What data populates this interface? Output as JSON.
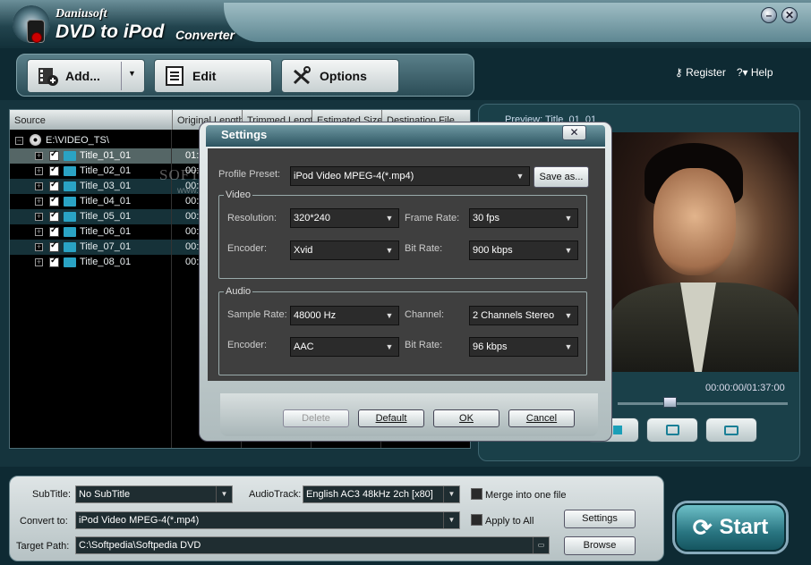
{
  "app": {
    "brand": "Daniusoft",
    "product": "DVD to iPod",
    "product_suffix": "Converter",
    "minimize_glyph": "–",
    "close_glyph": "✕"
  },
  "toolbar": {
    "add_label": "Add...",
    "edit_label": "Edit",
    "options_label": "Options",
    "register_label": "Register",
    "help_label": "Help"
  },
  "list": {
    "columns": [
      "Source",
      "Original Length",
      "Trimmed Length",
      "Estimated Size",
      "Destination File"
    ],
    "root": "E:\\VIDEO_TS\\",
    "items": [
      {
        "title": "Title_01_01",
        "length": "01:"
      },
      {
        "title": "Title_02_01",
        "length": "00:"
      },
      {
        "title": "Title_03_01",
        "length": "00:"
      },
      {
        "title": "Title_04_01",
        "length": "00:"
      },
      {
        "title": "Title_05_01",
        "length": "00:"
      },
      {
        "title": "Title_06_01",
        "length": "00:"
      },
      {
        "title": "Title_07_01",
        "length": "00:"
      },
      {
        "title": "Title_08_01",
        "length": "00:"
      }
    ]
  },
  "preview": {
    "title": "Preview: Title_01_01",
    "time": "00:00:00/01:37:00"
  },
  "settings": {
    "title": "Settings",
    "profile_label": "Profile Preset:",
    "profile_value": "iPod Video MPEG-4(*.mp4)",
    "save_as": "Save as...",
    "video_group": "Video",
    "resolution_label": "Resolution:",
    "resolution_value": "320*240",
    "frame_rate_label": "Frame Rate:",
    "frame_rate_value": "30 fps",
    "video_encoder_label": "Encoder:",
    "video_encoder_value": "Xvid",
    "video_bitrate_label": "Bit Rate:",
    "video_bitrate_value": "900 kbps",
    "audio_group": "Audio",
    "sample_rate_label": "Sample Rate:",
    "sample_rate_value": "48000 Hz",
    "channel_label": "Channel:",
    "channel_value": "2 Channels Stereo",
    "audio_encoder_label": "Encoder:",
    "audio_encoder_value": "AAC",
    "audio_bitrate_label": "Bit Rate:",
    "audio_bitrate_value": "96 kbps",
    "delete": "Delete",
    "default": "Default",
    "ok": "OK",
    "cancel": "Cancel"
  },
  "bottom": {
    "subtitle_label": "SubTitle:",
    "subtitle_value": "No SubTitle",
    "audiotrack_label": "AudioTrack:",
    "audiotrack_value": "English AC3 48kHz 2ch [x80]",
    "merge_label": "Merge into one file",
    "convert_label": "Convert to:",
    "convert_value": "iPod Video MPEG-4(*.mp4)",
    "apply_all_label": "Apply to All",
    "settings_button": "Settings",
    "target_label": "Target Path:",
    "target_value": "C:\\Softpedia\\Softpedia DVD",
    "browse_button": "Browse",
    "start_button": "Start"
  },
  "watermark": {
    "line1": "SOFTPEDIA",
    "line2": "www.softpedia.com"
  }
}
